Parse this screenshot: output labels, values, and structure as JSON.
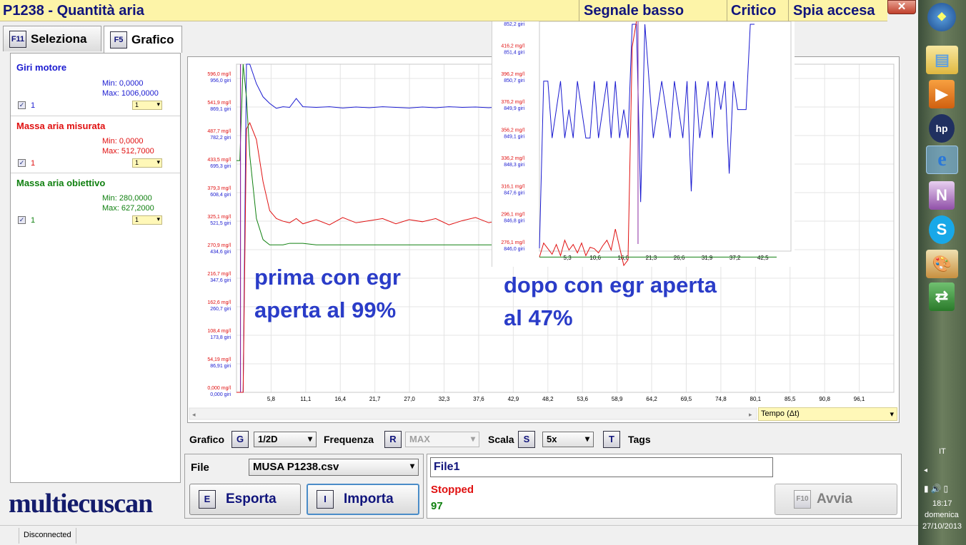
{
  "title": {
    "code_name": "P1238 - Quantità aria",
    "signal": "Segnale basso",
    "severity": "Critico",
    "lamp": "Spia accesa"
  },
  "tabs": [
    {
      "key": "F11",
      "label": "Seleziona"
    },
    {
      "key": "F5",
      "label": "Grafico"
    }
  ],
  "signals": [
    {
      "name": "Giri motore",
      "min": "Min: 0,0000",
      "max": "Max: 1006,0000",
      "checked": "✓",
      "count": "1",
      "sel": "1",
      "color": "#1a1ad0"
    },
    {
      "name": "Massa aria misurata",
      "min": "Min: 0,0000",
      "max": "Max: 512,7000",
      "checked": "✓",
      "count": "1",
      "sel": "1",
      "color": "#e01010"
    },
    {
      "name": "Massa aria obiettivo",
      "min": "Min: 280,0000",
      "max": "Max: 627,2000",
      "checked": "✓",
      "count": "1",
      "sel": "1",
      "color": "#108010"
    }
  ],
  "logo": "multiecuscan",
  "annotations": {
    "before_1": "prima con egr",
    "before_2": "aperta al 99%",
    "after_1": "dopo con egr aperta",
    "after_2": "al 47%"
  },
  "xaxis_title": "Tempo (Δt)",
  "controls": {
    "grafico_label": "Grafico",
    "grafico_key": "G",
    "grafico_value": "1/2D",
    "freq_label": "Frequenza",
    "freq_key": "R",
    "freq_value": "MAX",
    "scala_label": "Scala",
    "scala_key": "S",
    "scala_value": "5x",
    "tags_key": "T",
    "tags_label": "Tags"
  },
  "file": {
    "label": "File",
    "value": "MUSA P1238.csv",
    "name_box": "File1",
    "export_key": "E",
    "export_label": "Esporta",
    "import_key": "I",
    "import_label": "Importa"
  },
  "status": {
    "state": "Stopped",
    "count": "97",
    "run_key": "F10",
    "run_label": "Avvia"
  },
  "statusbar": {
    "connection": "Disconnected"
  },
  "taskbar": {
    "lang": "IT",
    "time": "18:17",
    "day": "domenica",
    "date": "27/10/2013"
  },
  "colors": {
    "rpm": "#1a1ad0",
    "measured": "#e01010",
    "target": "#108010",
    "title": "#10147c",
    "annotation": "#2a3cc8"
  },
  "chart_data": [
    {
      "type": "line",
      "x_ticks": [
        "5,8",
        "11,1",
        "16,4",
        "21,7",
        "27,0",
        "32,3",
        "37,6",
        "42,9",
        "48,2",
        "53,6",
        "58,9",
        "64,2",
        "69,5",
        "74,8",
        "80,1",
        "85,5",
        "90,8",
        "96,1"
      ],
      "x_range": [
        0,
        99
      ],
      "y_ticks_mass": [
        "0,000 mg/l",
        "54,19 mg/l",
        "108,4 mg/l",
        "162,6 mg/l",
        "216,7 mg/l",
        "270,9 mg/l",
        "325,1 mg/l",
        "379,3 mg/l",
        "433,5 mg/l",
        "487,7 mg/l",
        "541,9 mg/l",
        "596,0 mg/l"
      ],
      "y_ticks_rpm": [
        "0,000 giri",
        "86,91 giri",
        "173,8 giri",
        "260,7 giri",
        "347,6 giri",
        "434,6 giri",
        "521,5 giri",
        "608,4 giri",
        "695,3 giri",
        "782,2 giri",
        "869,1 giri",
        "956,0 giri"
      ],
      "series": [
        {
          "name": "Giri motore",
          "unit": "giri",
          "x": [
            0,
            1,
            1.5,
            2,
            3,
            4,
            5,
            6,
            7,
            8,
            9,
            10,
            12,
            14,
            16,
            18,
            20,
            22,
            24,
            26,
            28,
            30,
            32,
            34,
            36,
            38,
            40,
            42,
            44,
            46,
            48
          ],
          "y": [
            0,
            0,
            1000,
            1006,
            940,
            900,
            880,
            865,
            870,
            868,
            895,
            870,
            868,
            870,
            866,
            869,
            867,
            870,
            868,
            866,
            869,
            867,
            870,
            868,
            869,
            867,
            870,
            868,
            866,
            869,
            868
          ]
        },
        {
          "name": "Massa aria misurata",
          "unit": "mg/l",
          "x": [
            0,
            1,
            1.5,
            2,
            3,
            4,
            5,
            6,
            7,
            8,
            9,
            10,
            12,
            14,
            16,
            18,
            20,
            22,
            24,
            26,
            28,
            30,
            32,
            34,
            36,
            38,
            40,
            42,
            44,
            46,
            48
          ],
          "y": [
            0,
            0,
            500,
            512,
            480,
            400,
            345,
            330,
            325,
            322,
            330,
            320,
            328,
            318,
            332,
            322,
            326,
            330,
            320,
            328,
            324,
            330,
            318,
            326,
            332,
            322,
            328,
            324,
            330,
            334,
            328
          ]
        },
        {
          "name": "Massa aria obiettivo",
          "unit": "mg/l",
          "x": [
            0,
            0.5,
            1,
            1.5,
            2,
            3,
            4,
            5,
            6,
            7,
            8,
            9,
            10,
            12,
            14,
            16,
            18,
            20,
            22,
            24,
            26,
            28,
            30,
            32,
            34,
            36,
            38,
            40,
            42,
            44,
            46,
            48
          ],
          "y": [
            440,
            440,
            627,
            560,
            450,
            330,
            290,
            280,
            280,
            280,
            283,
            283,
            283,
            280,
            280,
            280,
            280,
            280,
            280,
            280,
            280,
            280,
            280,
            280,
            280,
            280,
            280,
            280,
            280,
            280,
            280,
            280
          ]
        }
      ],
      "legend": [
        "Giri motore",
        "Massa aria misurata",
        "Massa aria obiettivo"
      ],
      "legend_position": "top-right",
      "grid": true
    },
    {
      "type": "line",
      "x_ticks": [
        "5,3",
        "10,6",
        "16,0",
        "21,3",
        "26,6",
        "31,9",
        "37,2",
        "42,5"
      ],
      "x_range": [
        0,
        45
      ],
      "y_ticks_mass": [
        "276,1 mg/l",
        "296,1 mg/l",
        "316,1 mg/l",
        "336,2 mg/l",
        "356,2 mg/l",
        "376,2 mg/l",
        "396,2 mg/l",
        "416,2 mg/l"
      ],
      "y_ticks_rpm": [
        "846,0 giri",
        "846,8 giri",
        "847,6 giri",
        "848,3 giri",
        "849,1 giri",
        "849,9 giri",
        "850,7 giri",
        "851,4 giri",
        "852,2 giri"
      ],
      "series": [
        {
          "name": "Giri motore",
          "unit": "giri",
          "x": [
            0,
            0.8,
            1.6,
            2.4,
            3.2,
            4,
            4.8,
            5.6,
            6.4,
            7.2,
            8,
            8.8,
            9.6,
            10.4,
            11.2,
            12,
            12.8,
            13.6,
            14.4,
            15.2,
            16,
            16.8,
            17.6,
            18.4,
            19.2,
            20,
            20.8,
            21.6,
            22.4,
            23.2,
            24,
            24.8,
            25.6,
            26.4,
            27.2,
            28,
            28.8,
            29.6,
            30.4,
            31.2,
            32,
            32.8,
            33.6,
            34.4,
            35.2,
            36,
            36.8,
            37.6,
            38.4,
            39.2,
            40,
            40.8
          ],
          "y": [
            846,
            850.7,
            850.7,
            849.1,
            849.9,
            850.7,
            849.1,
            849.9,
            849.1,
            850.7,
            849.9,
            849.1,
            849.1,
            850.7,
            849.1,
            849.9,
            850.7,
            849.1,
            850.7,
            849.1,
            849.9,
            849.1,
            852.3,
            852.3,
            847.3,
            852.3,
            850.7,
            849.1,
            849.9,
            850.7,
            849.9,
            849.1,
            850.7,
            849.9,
            849.1,
            850.7,
            847.6,
            850.7,
            849.1,
            849.9,
            850.7,
            849.1,
            850.7,
            849.9,
            850.7,
            848.1,
            850.7,
            849.9,
            849.9,
            849.9,
            852.3,
            852.3
          ]
        },
        {
          "name": "Massa aria misurata",
          "unit": "mg/l",
          "x": [
            0,
            0.8,
            1.6,
            2.4,
            3.2,
            4,
            4.8,
            5.6,
            6.4,
            7.2,
            8,
            8.8,
            9.6,
            10.4,
            11.2,
            12,
            12.8,
            13.6,
            14.4,
            15.2,
            16,
            16.8,
            17.6,
            18.4
          ],
          "y": [
            280,
            290,
            286,
            282,
            289,
            281,
            292,
            285,
            289,
            283,
            290,
            281,
            287,
            286,
            283,
            288,
            292,
            285,
            300,
            287,
            274,
            278,
            430,
            600
          ]
        },
        {
          "name": "Massa aria obiettivo",
          "unit": "mg/l",
          "x": [
            0,
            18,
            18.5,
            45
          ],
          "y": [
            280,
            280,
            280,
            280
          ]
        }
      ],
      "legend": [
        "Giri motore",
        "Massa aria misurata",
        "Massa aria obiettivo"
      ],
      "legend_position": "top-right"
    }
  ]
}
